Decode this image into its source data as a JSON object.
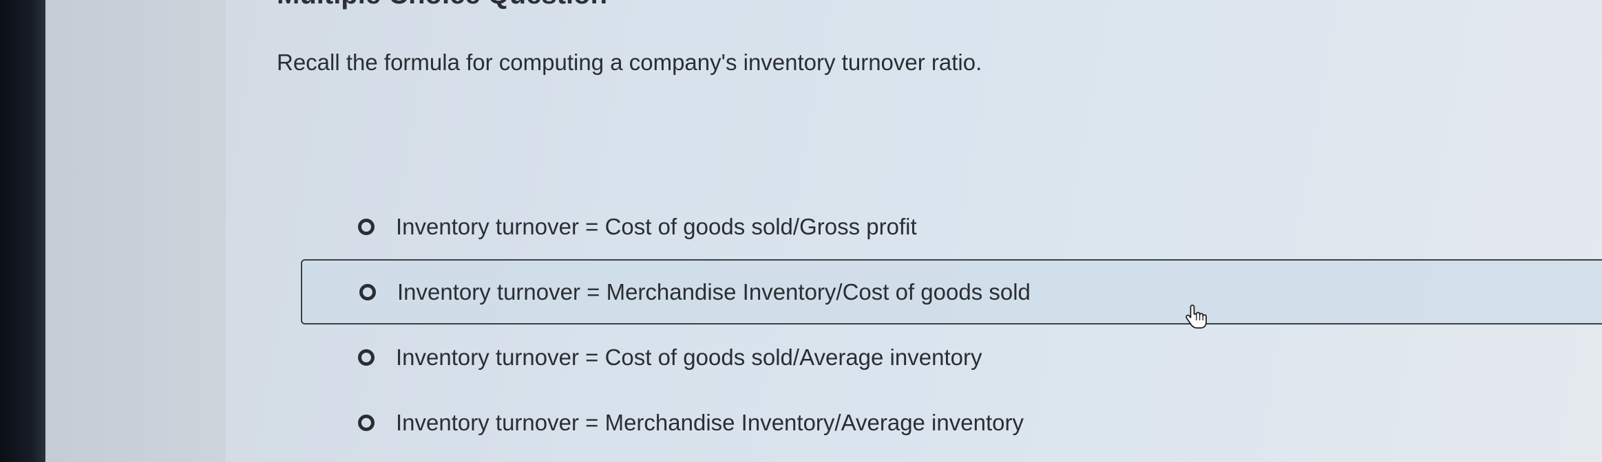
{
  "question": {
    "heading_partial": "Multiple Choice Question",
    "prompt": "Recall the formula for computing a company's inventory turnover ratio."
  },
  "options": [
    {
      "label": "Inventory turnover = Cost of goods sold/Gross profit",
      "selected": false
    },
    {
      "label": "Inventory turnover = Merchandise Inventory/Cost of goods sold",
      "selected": false,
      "hovered": true
    },
    {
      "label": "Inventory turnover = Cost of goods sold/Average inventory",
      "selected": false
    },
    {
      "label": "Inventory turnover = Merchandise Inventory/Average inventory",
      "selected": false
    }
  ],
  "icons": {
    "cursor": "hand-pointer-icon",
    "radio": "radio-button-icon"
  },
  "colors": {
    "text": "#2a2e33",
    "hover_border": "#3a4048",
    "background": "#d8e2ec"
  }
}
